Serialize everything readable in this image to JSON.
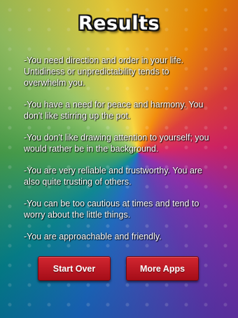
{
  "title": "Results",
  "results": [
    "-You need direction and order in your life. Untidiness or unpredictability tends to overwhelm you.",
    "-You have a need for peace and harmony. You don't like stirring up the pot.",
    "-You don't like drawing attention to yourself; you would rather be in the background.",
    "-You are very reliable and trustworthy. You are also quite trusting of others.",
    "-You can be too cautious at times and tend to worry about the little things.",
    "-You are approachable and friendly."
  ],
  "buttons": {
    "start_over": "Start Over",
    "more_apps": "More Apps"
  },
  "colors": {
    "button_red": "#c01824",
    "text": "#ffffff"
  }
}
